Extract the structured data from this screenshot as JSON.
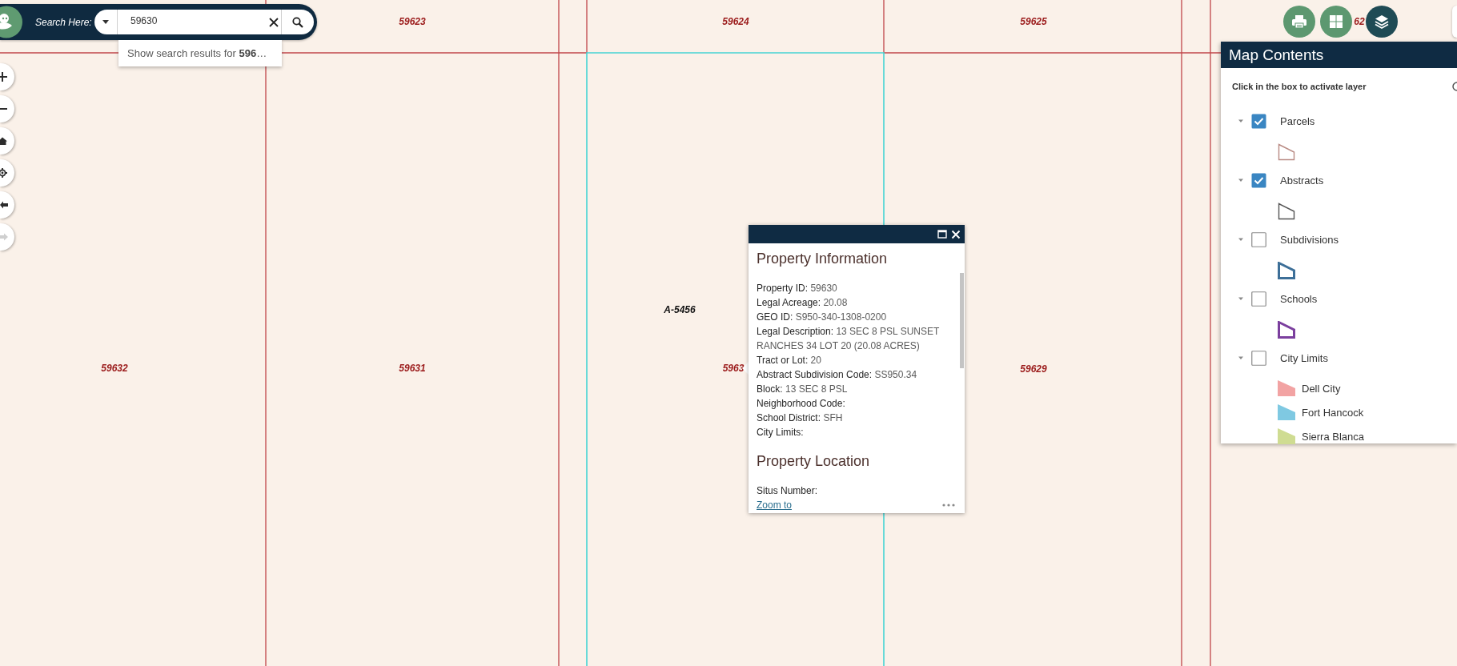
{
  "search": {
    "label": "Search Here:",
    "value": "59630",
    "suggestion": "Show search results for **596**…"
  },
  "map_controls": [
    {
      "kind": "zoom-in",
      "disabled": false
    },
    {
      "kind": "zoom-out",
      "disabled": false
    },
    {
      "kind": "home",
      "disabled": false
    },
    {
      "kind": "locate",
      "disabled": false
    },
    {
      "kind": "previous-extent",
      "disabled": false
    },
    {
      "kind": "next-extent",
      "disabled": true
    }
  ],
  "map_labels": [
    {
      "kind": "parcel",
      "text": "59623"
    },
    {
      "kind": "parcel",
      "text": "59624"
    },
    {
      "kind": "parcel",
      "text": "59625"
    },
    {
      "kind": "parcel",
      "text": "62"
    },
    {
      "kind": "abstract",
      "text": "A-5456"
    },
    {
      "kind": "parcel",
      "text": "59632"
    },
    {
      "kind": "parcel",
      "text": "59631"
    },
    {
      "kind": "parcel",
      "text": "5963"
    },
    {
      "kind": "parcel",
      "text": "59629"
    }
  ],
  "toolbar": [
    {
      "kind": "print",
      "selected": false
    },
    {
      "kind": "basemap",
      "selected": false
    },
    {
      "kind": "layers",
      "selected": true
    }
  ],
  "popup": {
    "sections": [
      {
        "title": "Property Information",
        "fields": [
          {
            "label": "Property ID:",
            "value": "59630"
          },
          {
            "label": "Legal Acreage:",
            "value": "20.08"
          },
          {
            "label": "GEO ID:",
            "value": "S950-340-1308-0200"
          },
          {
            "label": "Legal Description:",
            "value": "13 SEC 8 PSL SUNSET RANCHES 34 LOT 20 (20.08 ACRES)"
          },
          {
            "label": "Tract or Lot:",
            "value": "20"
          },
          {
            "label": "Abstract Subdivision Code:",
            "value": "SS950.34"
          },
          {
            "label": "Block:",
            "value": "13 SEC 8 PSL"
          },
          {
            "label": "Neighborhood Code:"
          },
          {
            "label": "School District:",
            "value": "SFH"
          },
          {
            "label": "City Limits:"
          }
        ]
      },
      {
        "title": "Property Location",
        "fields": [
          {
            "label": "Situs Number:"
          }
        ]
      }
    ],
    "link": "Zoom to"
  },
  "map_contents": {
    "title": "Map Contents",
    "hint": "Click in the box to activate layer",
    "layers": [
      {
        "name": "Parcels",
        "checked": true,
        "expanded": true,
        "legend": [
          {
            "kind": "outline",
            "color": "#b98b84"
          }
        ]
      },
      {
        "name": "Abstracts",
        "checked": true,
        "expanded": true,
        "legend": [
          {
            "kind": "outline",
            "color": "#555555"
          }
        ]
      },
      {
        "name": "Subdivisions",
        "checked": false,
        "expanded": true,
        "legend": [
          {
            "kind": "thick-outline",
            "color": "#3d6f98"
          }
        ]
      },
      {
        "name": "Schools",
        "checked": false,
        "expanded": true,
        "legend": [
          {
            "kind": "thick-outline",
            "color": "#7b3f9e"
          }
        ]
      },
      {
        "name": "City Limits",
        "checked": false,
        "expanded": true,
        "legend": [
          {
            "kind": "fill",
            "color": "#f2a3a3",
            "label": "Dell City"
          },
          {
            "kind": "fill",
            "color": "#7fc9e2",
            "label": "Fort Hancock"
          },
          {
            "kind": "fill",
            "color": "#cfdc92",
            "label": "Sierra Blanca"
          }
        ]
      }
    ]
  }
}
